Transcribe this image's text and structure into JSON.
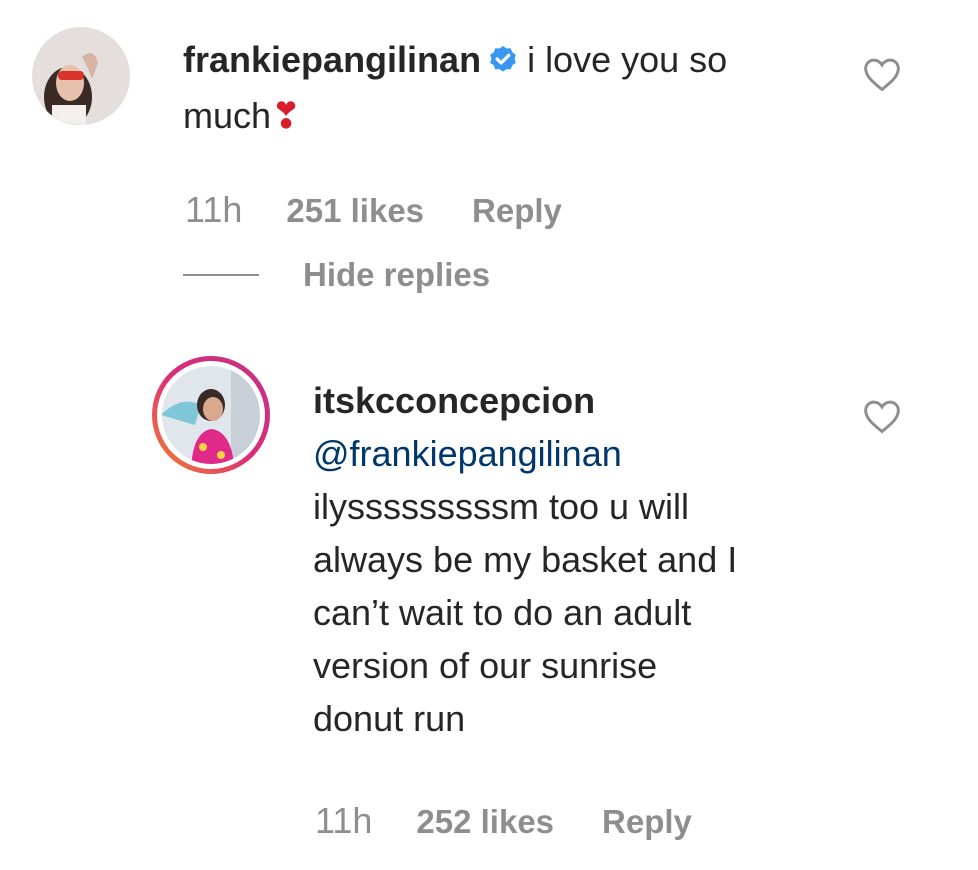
{
  "comment": {
    "username": "frankiepangilinan",
    "text_line1": "i love you so",
    "text_line2": "much",
    "emoji": "❣",
    "time": "11h",
    "likes": "251 likes",
    "reply_label": "Reply",
    "hide_replies_label": "Hide replies"
  },
  "reply": {
    "username": "itskcconcepcion",
    "mention": "@frankiepangilinan",
    "lines": [
      "ilysssssssssm too u will",
      "always be my basket and I",
      "can’t wait to do an adult",
      "version of our sunrise",
      "donut run"
    ],
    "time": "11h",
    "likes": "252 likes",
    "reply_label": "Reply"
  },
  "colors": {
    "verified": "#3897f0",
    "mention": "#00376b",
    "meta": "#8e8e8e",
    "story_ring_start": "#f58529",
    "story_ring_end": "#dd2a7b"
  },
  "icons": {
    "verified": "verified-badge-icon",
    "like": "heart-outline-icon"
  }
}
